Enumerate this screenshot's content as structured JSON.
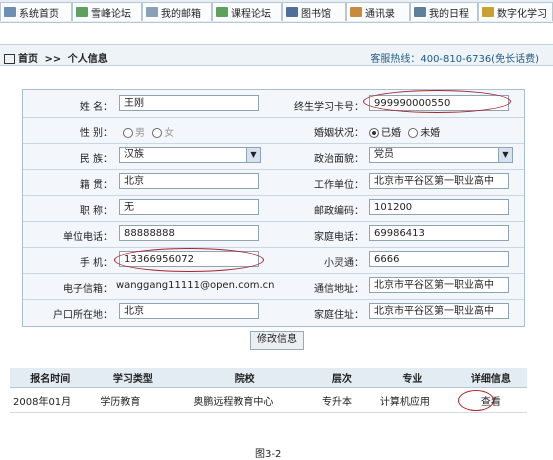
{
  "tabs": [
    {
      "label": "系统首页",
      "icon": "home-icon",
      "color": "#6c8fb2"
    },
    {
      "label": "雪峰论坛",
      "icon": "forum-icon",
      "color": "#5ea05e"
    },
    {
      "label": "我的邮箱",
      "icon": "mail-icon",
      "color": "#8aa0b8"
    },
    {
      "label": "课程论坛",
      "icon": "course-forum-icon",
      "color": "#5ea05e"
    },
    {
      "label": "图书馆",
      "icon": "book-icon",
      "color": "#4d6f9a"
    },
    {
      "label": "通讯录",
      "icon": "contacts-icon",
      "color": "#c88a3c"
    },
    {
      "label": "我的日程",
      "icon": "calendar-icon",
      "color": "#5f7f9f"
    },
    {
      "label": "数字化学习",
      "icon": "learning-icon",
      "color": "#c9a032"
    }
  ],
  "breadcrumb": {
    "home": "首页",
    "separator": ">>",
    "current": "个人信息"
  },
  "hotline": "客服热线：400-810-6736(免长话费)",
  "form": {
    "name_label": "姓 名：",
    "name_value": "王刚",
    "card_label": "终生学习卡号：",
    "card_value": "999990000550",
    "gender_label": "性 别：",
    "gender_male": "男",
    "gender_female": "女",
    "marital_label": "婚姻状况：",
    "marital_married": "已婚",
    "marital_single": "未婚",
    "ethnic_label": "民 族：",
    "ethnic_value": "汉族",
    "political_label": "政治面貌：",
    "political_value": "党员",
    "native_label": "籍 贯：",
    "native_value": "北京",
    "work_label": "工作单位：",
    "work_value": "北京市平谷区第一职业高中",
    "title_label": "职 称：",
    "title_value": "无",
    "zip_label": "邮政编码：",
    "zip_value": "101200",
    "workphone_label": "单位电话：",
    "workphone_value": "88888888",
    "homephone_label": "家庭电话：",
    "homephone_value": "69986413",
    "mobile_label": "手 机：",
    "mobile_value": "13366956072",
    "pas_label": "小灵通：",
    "pas_value": "6666",
    "email_label": "电子信箱：",
    "email_value": "wanggang11111@open.com.cn",
    "address_label": "通信地址：",
    "address_value": "北京市平谷区第一职业高中",
    "hukou_label": "户口所在地：",
    "hukou_value": "北京",
    "home_addr_label": "家庭住址：",
    "home_addr_value": "北京市平谷区第一职业高中"
  },
  "modify_button": "修改信息",
  "table": {
    "headers": [
      "报名时间",
      "学习类型",
      "院校",
      "层次",
      "专业",
      "详细信息"
    ],
    "row": [
      "2008年01月",
      "学历教育",
      "奥鹏远程教育中心",
      "专升本",
      "计算机应用",
      "查看"
    ]
  },
  "caption": "图3-2",
  "accent_color": "#a8232b"
}
